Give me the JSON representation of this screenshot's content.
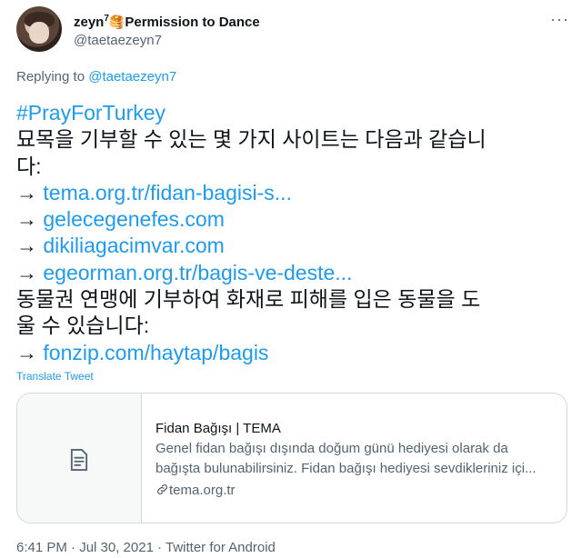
{
  "user": {
    "display_name": "zeyn",
    "display_name_sup": "7",
    "display_name_emoji": "🥞",
    "display_name_suffix": "Permission to Dance",
    "handle": "@taetaezeyn7"
  },
  "more_icon": "more-horizontal-icon",
  "replying": {
    "prefix": "Replying to ",
    "mention": "@taetaezeyn7"
  },
  "tweet": {
    "hashtag": "#PrayForTurkey",
    "line1": "묘목을 기부할 수 있는 몇 가지 사이트는 다음과 같습니",
    "line2": "다:",
    "arrow": "→ ",
    "links": [
      "tema.org.tr/fidan-bagisi-s...",
      "gelecegenefes.com",
      "dikiliagacimvar.com",
      "egeorman.org.tr/bagis-ve-deste..."
    ],
    "line_animal1": "동물권 연맹에 기부하여 화재로 피해를 입은 동물을 도",
    "line_animal2": "울 수 있습니다:",
    "link_last": "fonzip.com/haytap/bagis"
  },
  "translate": "Translate Tweet",
  "card": {
    "icon": "document-icon",
    "title": "Fidan Bağışı | TEMA",
    "desc1": "Genel fidan bağışı dışında doğum günü hediyesi olarak da",
    "desc2": "bağışta bulunabilirsiniz. Fidan bağışı hediyesi sevdikleriniz içi...",
    "domain_icon": "link-icon",
    "domain": "tema.org.tr"
  },
  "meta": "6:41 PM · Jul 30, 2021 · Twitter for Android",
  "colors": {
    "accent": "#1d9bf0",
    "muted": "#536471",
    "text": "#0f1419",
    "border": "#cfd9de"
  }
}
